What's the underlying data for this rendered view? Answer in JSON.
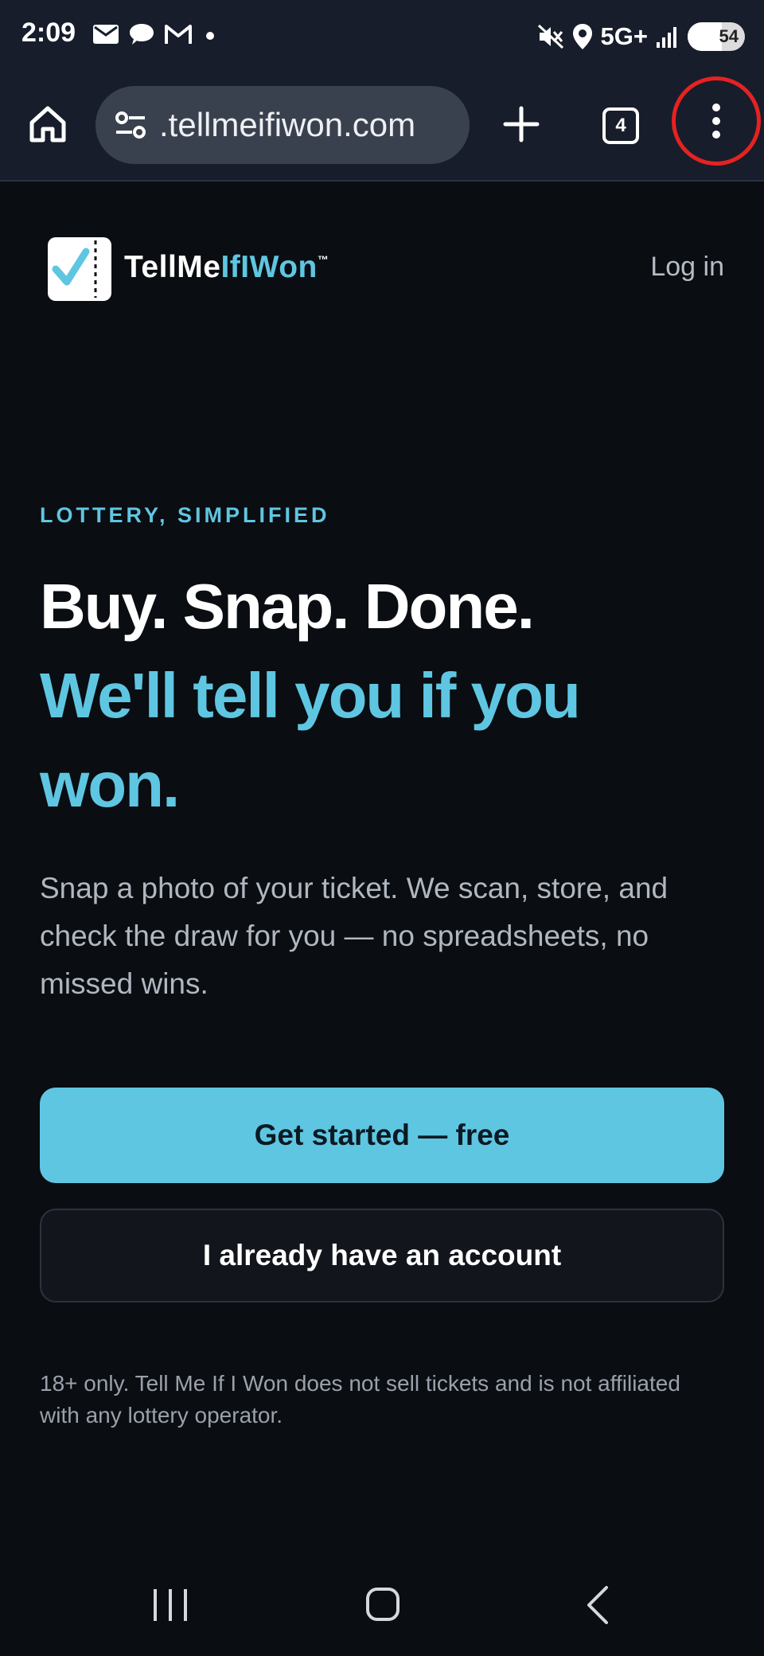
{
  "status_bar": {
    "time": "2:09",
    "network": "5G+",
    "battery": "54",
    "left_icons": [
      "mail-icon",
      "chat-icon",
      "gmail-icon",
      "dot-icon"
    ],
    "right_icons": [
      "mute-icon",
      "location-icon",
      "signal-icon",
      "battery-icon"
    ]
  },
  "browser": {
    "url": ".tellmeifiwon.com",
    "tab_count": "4",
    "icons": [
      "home-icon",
      "site-settings-icon",
      "new-tab-icon",
      "tabs-icon",
      "more-menu-icon"
    ]
  },
  "site": {
    "brand_prefix": "TellMe",
    "brand_accent": "IfIWon",
    "brand_tm": "™",
    "login": "Log in"
  },
  "hero": {
    "eyebrow": "LOTTERY, SIMPLIFIED",
    "headline_1": "Buy. Snap. Done.",
    "headline_2": "We'll tell you if you won.",
    "subtext": "Snap a photo of your ticket. We scan, store, and check the draw for you — no spreadsheets, no missed wins.",
    "primary_cta": "Get started — free",
    "secondary_cta": "I already have an account",
    "disclaimer": "18+ only. Tell Me If I Won does not sell tickets and is not affiliated with any lottery operator."
  },
  "colors": {
    "accent": "#5fc6e2",
    "background": "#0a0d11",
    "browser_chrome": "#171d2a",
    "highlight_ring": "#e52222"
  }
}
